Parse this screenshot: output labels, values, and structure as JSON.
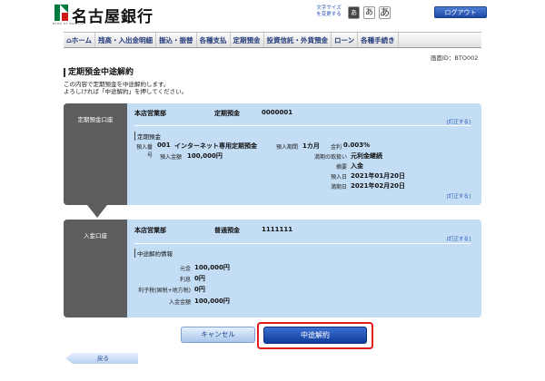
{
  "header": {
    "bank_name": "名古屋銀行",
    "logo_sub": "BANK OF NAGOYA",
    "font_size_label": "文字サイズを変更する",
    "font_small": "あ",
    "font_medium": "あ",
    "font_large": "あ",
    "logout_label": "ログアウト"
  },
  "nav": {
    "items": [
      {
        "label": "ホーム",
        "icon": "home-icon"
      },
      {
        "label": "残高・入出金明細"
      },
      {
        "label": "振込・振替"
      },
      {
        "label": "各種支払"
      },
      {
        "label": "定期預金"
      },
      {
        "label": "投資信託・外貨預金"
      },
      {
        "label": "ローン"
      },
      {
        "label": "各種手続き"
      }
    ]
  },
  "screen_id": "画面ID：BTO002",
  "page": {
    "title": "定期預金中途解約",
    "desc_line1": "この内容で定期預金を中途解約します。",
    "desc_line2": "よろしければ「中途解約」を押してください。"
  },
  "time_deposit": {
    "section_label": "定期預金口座",
    "branch": "本店営業部",
    "account_type": "定期預金",
    "account_number": "0000001",
    "change_label": "[訂正する]",
    "sub_title": "定期預金",
    "deposit_no_label": "預入番号",
    "deposit_no": "001",
    "product_name": "インターネット専用定期預金",
    "period_label": "預入期間",
    "period": "1カ月",
    "rate_label": "金利",
    "rate": "0.003%",
    "amount_label": "預入金額",
    "amount": "100,000円",
    "maturity_handling_label": "満期の取扱い",
    "maturity_handling": "元利金継続",
    "tax_label": "摘要",
    "tax": "入金",
    "deposit_date_label": "預入日",
    "deposit_date": "2021年01月20日",
    "maturity_date_label": "満期日",
    "maturity_date": "2021年02月20日",
    "change_label2": "[訂正する]"
  },
  "deposit_account": {
    "section_label": "入金口座",
    "branch": "本店営業部",
    "account_type": "普通預金",
    "account_number": "1111111",
    "change_label": "[訂正する]",
    "sub_title": "中途解約情報",
    "principal_label": "元金",
    "principal": "100,000円",
    "interest_label": "利息",
    "interest": "0円",
    "tax_label": "利子税(国税+地方税)",
    "tax": "0円",
    "total_label": "入金金額",
    "total": "100,000円"
  },
  "actions": {
    "cancel_label": "キャンセル",
    "confirm_label": "中途解約",
    "back_label": "戻る"
  }
}
